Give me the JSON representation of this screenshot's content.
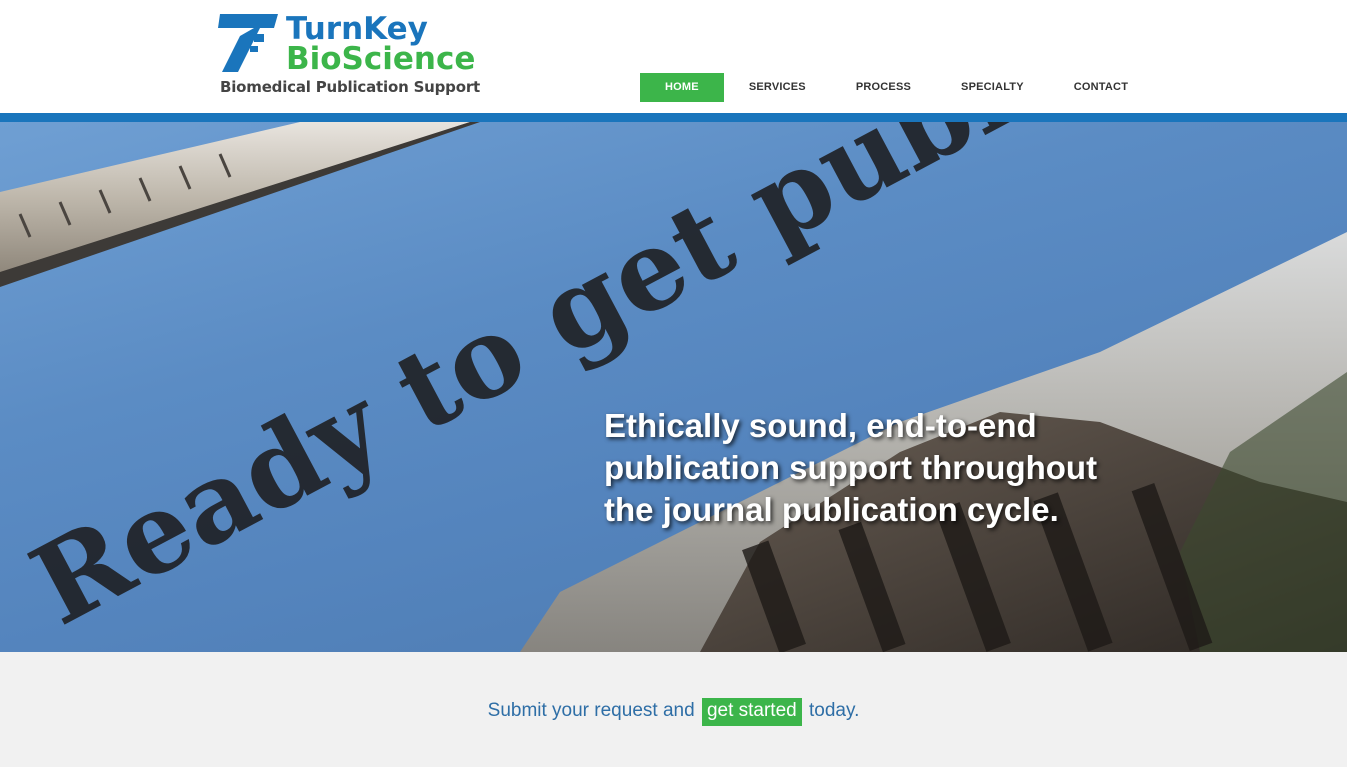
{
  "brand": {
    "name_line1": "TurnKey",
    "name_line2": "BioScience",
    "tagline": "Biomedical Publication Support",
    "colors": {
      "blue": "#1a75bc",
      "green": "#3cb54a",
      "gray": "#444444"
    }
  },
  "nav": {
    "items": [
      {
        "label": "HOME",
        "active": true
      },
      {
        "label": "SERVICES",
        "active": false
      },
      {
        "label": "PROCESS",
        "active": false
      },
      {
        "label": "SPECIALTY",
        "active": false
      },
      {
        "label": "CONTACT",
        "active": false
      }
    ]
  },
  "hero": {
    "image_text": "Ready to get published",
    "headline_lines": [
      "Ethically sound, end-to-end",
      "publication support throughout",
      "the journal publication cycle."
    ]
  },
  "cta": {
    "before": "Submit your request and ",
    "button_label": "get started",
    "after": " today."
  }
}
